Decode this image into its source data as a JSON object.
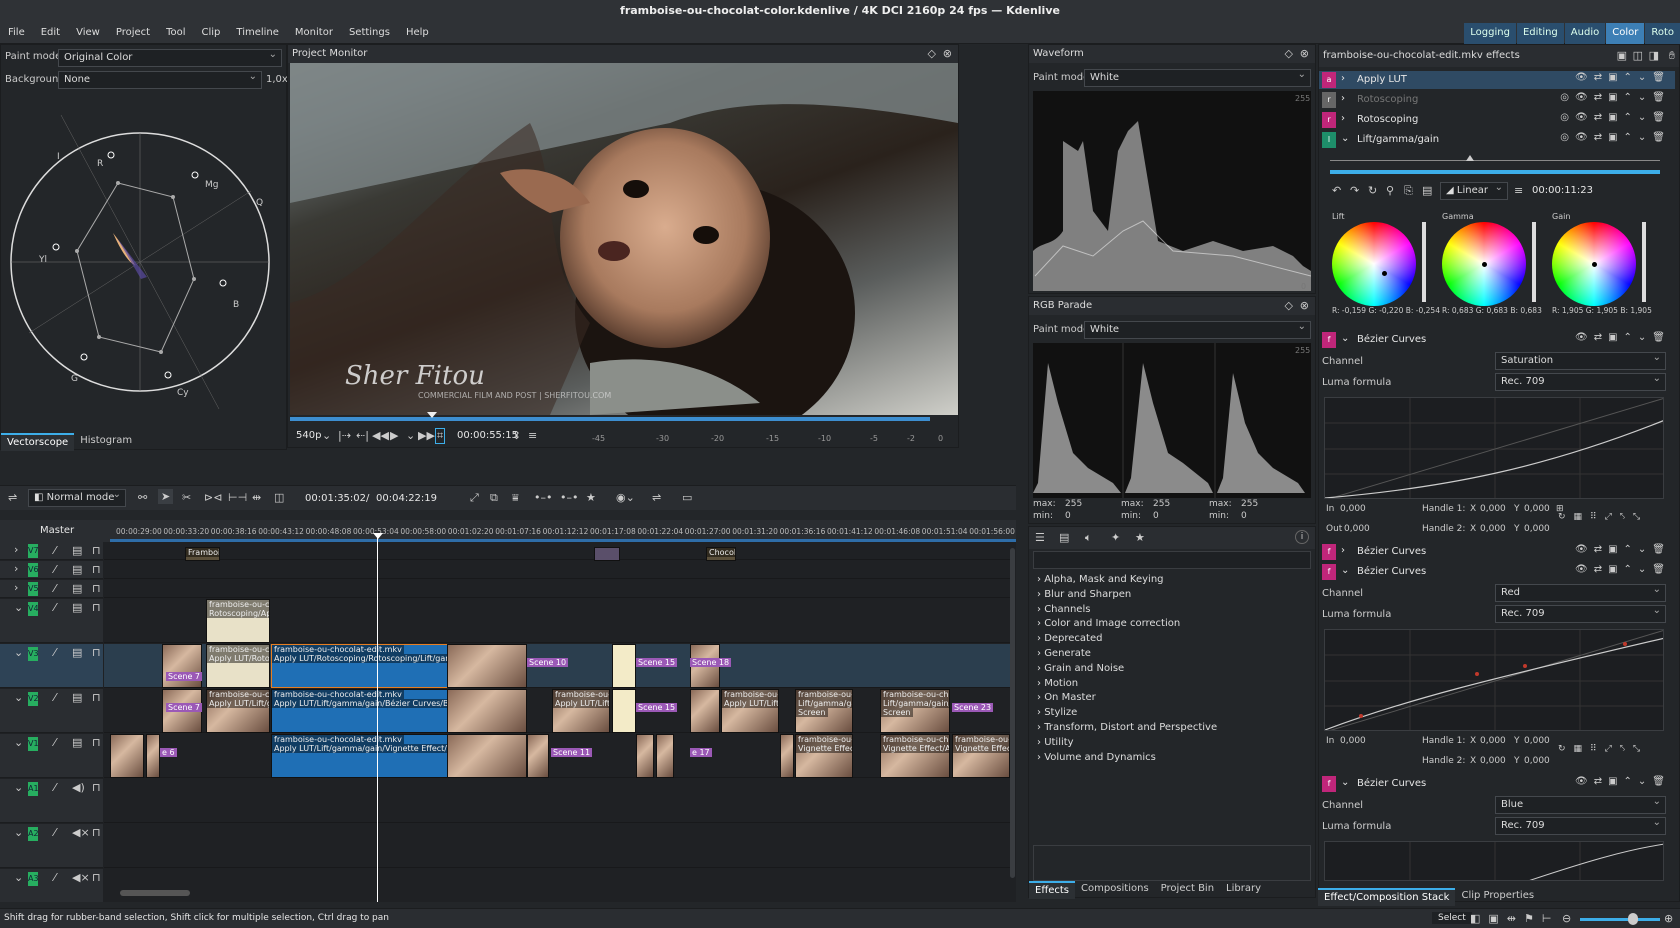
{
  "title": "framboise-ou-chocolat-color.kdenlive / 4K DCI 2160p 24 fps — Kdenlive",
  "menu": [
    "File",
    "Edit",
    "View",
    "Project",
    "Tool",
    "Clip",
    "Timeline",
    "Monitor",
    "Settings",
    "Help"
  ],
  "layouts": [
    "Logging",
    "Editing",
    "Audio",
    "Color",
    "Roto"
  ],
  "vectorscope": {
    "paint_mode_label": "Paint mode",
    "paint_mode": "Original Color",
    "background_label": "Background",
    "background": "None",
    "zoom": "1,0x",
    "labels": {
      "i": "I",
      "r": "R",
      "mg": "Mg",
      "q": "Q",
      "yl": "Yl",
      "b": "B",
      "g": "G",
      "cy": "Cy"
    },
    "tabs": [
      "Vectorscope",
      "Histogram"
    ]
  },
  "monitor": {
    "title": "Project Monitor",
    "resolution": "540p",
    "timecode": "00:00:55:15",
    "ruler": [
      "-45",
      "-30",
      "-20",
      "-15",
      "-10",
      "-5",
      "-2",
      "0"
    ],
    "watermark": "Sher Fitou",
    "watermark_sub": "COMMERCIAL FILM AND POST | SHERFITOU.COM"
  },
  "waveform": {
    "title": "Waveform",
    "paint_mode_label": "Paint mode",
    "paint_mode": "White",
    "scale_top": "255",
    "scale_bottom": "0"
  },
  "parade": {
    "title": "RGB Parade",
    "paint_mode_label": "Paint mode",
    "paint_mode": "White",
    "scale_top": "255",
    "stats": [
      {
        "max": "255",
        "min": "0"
      },
      {
        "max": "255",
        "min": "0"
      },
      {
        "max": "255",
        "min": "0"
      }
    ],
    "max_label": "max:",
    "min_label": "min:"
  },
  "effects_browser": {
    "categories": [
      "Alpha, Mask and Keying",
      "Blur and Sharpen",
      "Channels",
      "Color and Image correction",
      "Deprecated",
      "Generate",
      "Grain and Noise",
      "Motion",
      "On Master",
      "Stylize",
      "Transform, Distort and Perspective",
      "Utility",
      "Volume and Dynamics"
    ],
    "tabs": [
      "Effects",
      "Compositions",
      "Project Bin",
      "Library"
    ]
  },
  "effect_stack": {
    "title": "framboise-ou-chocolat-edit.mkv effects",
    "items": [
      {
        "badge": "a",
        "label": "Apply LUT",
        "color": "#c0267a"
      },
      {
        "badge": "r",
        "label": "Rotoscoping",
        "color": "#666",
        "disabled": true
      },
      {
        "badge": "r",
        "label": "Rotoscoping",
        "color": "#c0267a"
      },
      {
        "badge": "l",
        "label": "Lift/gamma/gain",
        "color": "#1e8e6a"
      }
    ],
    "interp": "Linear",
    "kf_time": "00:00:11:23",
    "wheels": [
      {
        "name": "Lift",
        "vals": "R: -0,159  G: -0,220  B: -0,254"
      },
      {
        "name": "Gamma",
        "vals": "R: 0,683  G: 0,683  B: 0,683"
      },
      {
        "name": "Gain",
        "vals": "R: 1,905  G: 1,905  B: 1,905"
      }
    ],
    "curves": [
      {
        "label": "Bézier Curves",
        "channel": "Saturation",
        "luma": "Rec. 709"
      },
      {
        "label": "Bézier Curves"
      },
      {
        "label": "Bézier Curves",
        "channel": "Red",
        "luma": "Rec. 709"
      },
      {
        "label": "Bézier Curves",
        "channel": "Blue",
        "luma": "Rec. 709"
      }
    ],
    "channel_label": "Channel",
    "luma_label": "Luma formula",
    "in_label": "In",
    "out_label": "Out",
    "in_val": "0,000",
    "out_val": "0,000",
    "h1": "Handle 1:",
    "h2": "Handle 2:",
    "x": "X",
    "y": "Y",
    "hval": "0,000",
    "tabs": [
      "Effect/Composition Stack",
      "Clip Properties"
    ]
  },
  "timeline": {
    "mode": "Normal mode",
    "position": "00:01:35:02",
    "duration": "00:04:22:19",
    "master": "Master",
    "ruler": [
      "00:00:29:00",
      "00:00:33:20",
      "00:00:38:16",
      "00:00:43:12",
      "00:00:48:08",
      "00:00:53:04",
      "00:00:58:00",
      "00:01:02:20",
      "00:01:07:16",
      "00:01:12:12",
      "00:01:17:08",
      "00:01:22:04",
      "00:01:27:00",
      "00:01:31:20",
      "00:01:36:16",
      "00:01:41:12",
      "00:01:46:08",
      "00:01:51:04",
      "00:01:56:00"
    ],
    "tracks": [
      "V7",
      "V6",
      "V5",
      "V4",
      "V3",
      "V2",
      "V1",
      "A1",
      "A2",
      "A3"
    ],
    "clip_name": "framboise-ou-chocolat-edit.mkv",
    "clip_short": "framboise-ou-choc",
    "fx1": "Apply LUT/Rotoscoping/Rotoscoping/Lift/gamma/g",
    "fx2": "Apply LUT/Lift/gamma/gain/Bézier Curves/Bézier",
    "fx3": "Apply LUT/Lift/gamma/gain/Vignette Effect/Bézier C",
    "roto": "Rotoscoping/Appl",
    "applyrot": "Apply LUT/Rotosc",
    "applylift": "Apply LUT/Lift/ga",
    "lgg": "Lift/gamma/gain/",
    "vign": "Vignette Effect/A",
    "screen": "Screen",
    "scenes": {
      "s7": "Scene 7",
      "s10": "Scene 10",
      "s15": "Scene 15",
      "s18": "Scene 18",
      "s23": "Scene 23",
      "s11": "Scene 11",
      "s17": "e 17",
      "s6": "e 6",
      "s15b": "Scene 15",
      "s7b": "Scene 7"
    },
    "fr": "Framboi",
    "choc": "Chocolat"
  },
  "status": {
    "text": "Shift drag for rubber-band selection, Shift click for multiple selection, Ctrl drag to pan",
    "select": "Select"
  }
}
